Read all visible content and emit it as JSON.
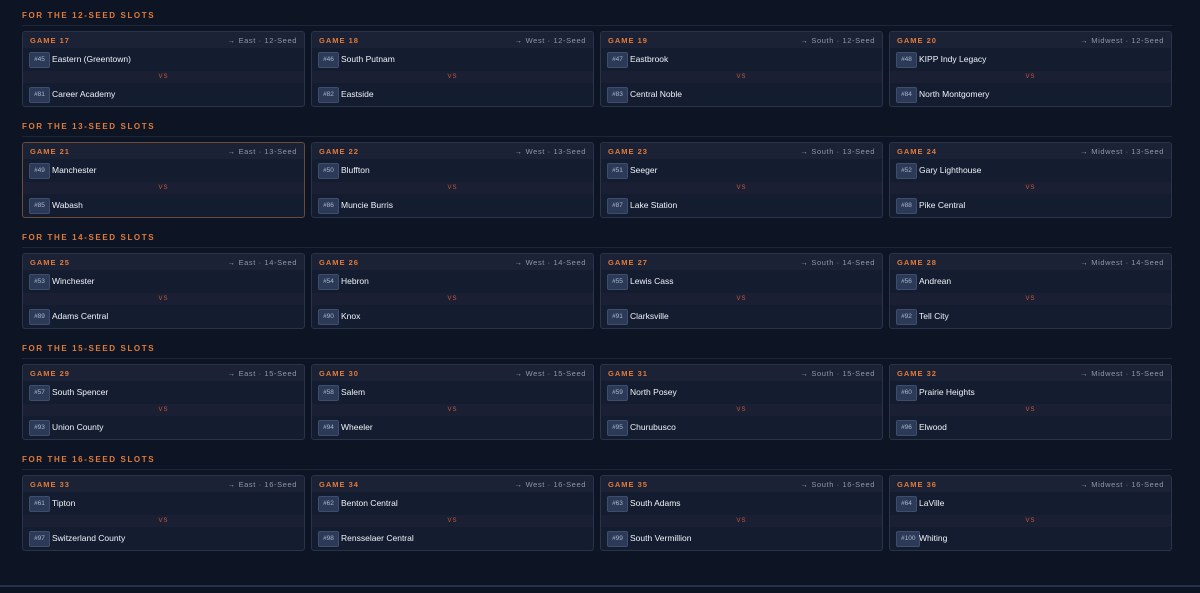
{
  "sections": [
    {
      "title": "For the 12-Seed Slots",
      "games": [
        {
          "game": "GAME 17",
          "dest": "East · 12-Seed",
          "team1": {
            "seed": "#45",
            "name": "Eastern (Greentown)"
          },
          "team2": {
            "seed": "#81",
            "name": "Career Academy"
          }
        },
        {
          "game": "GAME 18",
          "dest": "West · 12-Seed",
          "team1": {
            "seed": "#46",
            "name": "South Putnam"
          },
          "team2": {
            "seed": "#82",
            "name": "Eastside"
          }
        },
        {
          "game": "GAME 19",
          "dest": "South · 12-Seed",
          "team1": {
            "seed": "#47",
            "name": "Eastbrook"
          },
          "team2": {
            "seed": "#83",
            "name": "Central Noble"
          }
        },
        {
          "game": "GAME 20",
          "dest": "Midwest · 12-Seed",
          "team1": {
            "seed": "#48",
            "name": "KIPP Indy Legacy"
          },
          "team2": {
            "seed": "#84",
            "name": "North Montgomery"
          }
        }
      ]
    },
    {
      "title": "For the 13-Seed Slots",
      "games": [
        {
          "game": "GAME 21",
          "dest": "East · 13-Seed",
          "team1": {
            "seed": "#49",
            "name": "Manchester"
          },
          "team2": {
            "seed": "#85",
            "name": "Wabash"
          }
        },
        {
          "game": "GAME 22",
          "dest": "West · 13-Seed",
          "team1": {
            "seed": "#50",
            "name": "Bluffton"
          },
          "team2": {
            "seed": "#86",
            "name": "Muncie Burris"
          }
        },
        {
          "game": "GAME 23",
          "dest": "South · 13-Seed",
          "team1": {
            "seed": "#51",
            "name": "Seeger"
          },
          "team2": {
            "seed": "#87",
            "name": "Lake Station"
          }
        },
        {
          "game": "GAME 24",
          "dest": "Midwest · 13-Seed",
          "team1": {
            "seed": "#52",
            "name": "Gary Lighthouse"
          },
          "team2": {
            "seed": "#88",
            "name": "Pike Central"
          }
        }
      ]
    },
    {
      "title": "For the 14-Seed Slots",
      "games": [
        {
          "game": "GAME 25",
          "dest": "East · 14-Seed",
          "team1": {
            "seed": "#53",
            "name": "Winchester"
          },
          "team2": {
            "seed": "#89",
            "name": "Adams Central"
          }
        },
        {
          "game": "GAME 26",
          "dest": "West · 14-Seed",
          "team1": {
            "seed": "#54",
            "name": "Hebron"
          },
          "team2": {
            "seed": "#90",
            "name": "Knox"
          }
        },
        {
          "game": "GAME 27",
          "dest": "South · 14-Seed",
          "team1": {
            "seed": "#55",
            "name": "Lewis Cass"
          },
          "team2": {
            "seed": "#91",
            "name": "Clarksville"
          }
        },
        {
          "game": "GAME 28",
          "dest": "Midwest · 14-Seed",
          "team1": {
            "seed": "#56",
            "name": "Andrean"
          },
          "team2": {
            "seed": "#92",
            "name": "Tell City"
          }
        }
      ]
    },
    {
      "title": "For the 15-Seed Slots",
      "games": [
        {
          "game": "GAME 29",
          "dest": "East · 15-Seed",
          "team1": {
            "seed": "#57",
            "name": "South Spencer"
          },
          "team2": {
            "seed": "#93",
            "name": "Union County"
          }
        },
        {
          "game": "GAME 30",
          "dest": "West · 15-Seed",
          "team1": {
            "seed": "#58",
            "name": "Salem"
          },
          "team2": {
            "seed": "#94",
            "name": "Wheeler"
          }
        },
        {
          "game": "GAME 31",
          "dest": "South · 15-Seed",
          "team1": {
            "seed": "#59",
            "name": "North Posey"
          },
          "team2": {
            "seed": "#95",
            "name": "Churubusco"
          }
        },
        {
          "game": "GAME 32",
          "dest": "Midwest · 15-Seed",
          "team1": {
            "seed": "#60",
            "name": "Prairie Heights"
          },
          "team2": {
            "seed": "#96",
            "name": "Elwood"
          }
        }
      ]
    },
    {
      "title": "For the 16-Seed Slots",
      "games": [
        {
          "game": "GAME 33",
          "dest": "East · 16-Seed",
          "team1": {
            "seed": "#61",
            "name": "Tipton"
          },
          "team2": {
            "seed": "#97",
            "name": "Switzerland County"
          }
        },
        {
          "game": "GAME 34",
          "dest": "West · 16-Seed",
          "team1": {
            "seed": "#62",
            "name": "Benton Central"
          },
          "team2": {
            "seed": "#98",
            "name": "Rensselaer Central"
          }
        },
        {
          "game": "GAME 35",
          "dest": "South · 16-Seed",
          "team1": {
            "seed": "#63",
            "name": "South Adams"
          },
          "team2": {
            "seed": "#99",
            "name": "South Vermillion"
          }
        },
        {
          "game": "GAME 36",
          "dest": "Midwest · 16-Seed",
          "team1": {
            "seed": "#64",
            "name": "LaVille"
          },
          "team2": {
            "seed": "#100",
            "name": "Whiting"
          }
        }
      ]
    }
  ],
  "vs_label": "VS",
  "arrow_glyph": "→",
  "highlighted_game": "GAME 21",
  "colors": {
    "accent": "#e07a3a",
    "background": "#0d1524",
    "card": "#141d30",
    "seed_badge": "#2c3a57",
    "vs_text": "#c85a3a"
  }
}
